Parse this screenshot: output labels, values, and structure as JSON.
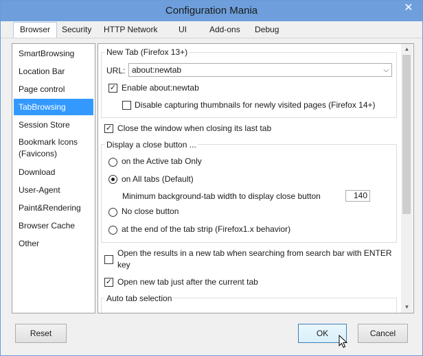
{
  "window": {
    "title": "Configuration Mania",
    "close_glyph": "✕"
  },
  "menu": [
    "Browser",
    "Security",
    "HTTP Network",
    "UI",
    "Add-ons",
    "Debug"
  ],
  "sidebar": {
    "items": [
      "SmartBrowsing",
      "Location Bar",
      "Page control",
      "TabBrowsing",
      "Session Store",
      "Bookmark Icons (Favicons)",
      "Download",
      "User-Agent",
      "Paint&Rendering",
      "Browser Cache",
      "Other"
    ],
    "selected": "TabBrowsing"
  },
  "newtab": {
    "title": "New Tab (Firefox 13+)",
    "url_label": "URL:",
    "url_value": "about:newtab",
    "enable_label": "Enable about:newtab",
    "enable_checked": true,
    "disable_thumbs_label": "Disable capturing thumbnails for newly visited pages (Firefox 14+)",
    "disable_thumbs_checked": false
  },
  "close_last_tab": {
    "label": "Close the window when closing its last tab",
    "checked": true
  },
  "close_button": {
    "title": "Display a close button ...",
    "options": [
      "on the Active tab Only",
      "on All tabs (Default)",
      "No close button",
      "at the end of the tab strip (Firefox1.x behavior)"
    ],
    "selected_index": 1,
    "min_width_label": "Minimum background-tab width to display close button",
    "min_width_value": "140"
  },
  "search_newtab": {
    "label_line1": "Open the results in a new tab when searching from search bar with ENTER",
    "label_line2": "key",
    "checked": false
  },
  "open_after_current": {
    "label": "Open new tab just after the current tab",
    "checked": true
  },
  "auto_tab": {
    "title": "Auto tab selection"
  },
  "buttons": {
    "reset": "Reset",
    "ok": "OK",
    "cancel": "Cancel"
  },
  "colors": {
    "titlebar": "#6e9fdc",
    "selection": "#3399ff"
  }
}
